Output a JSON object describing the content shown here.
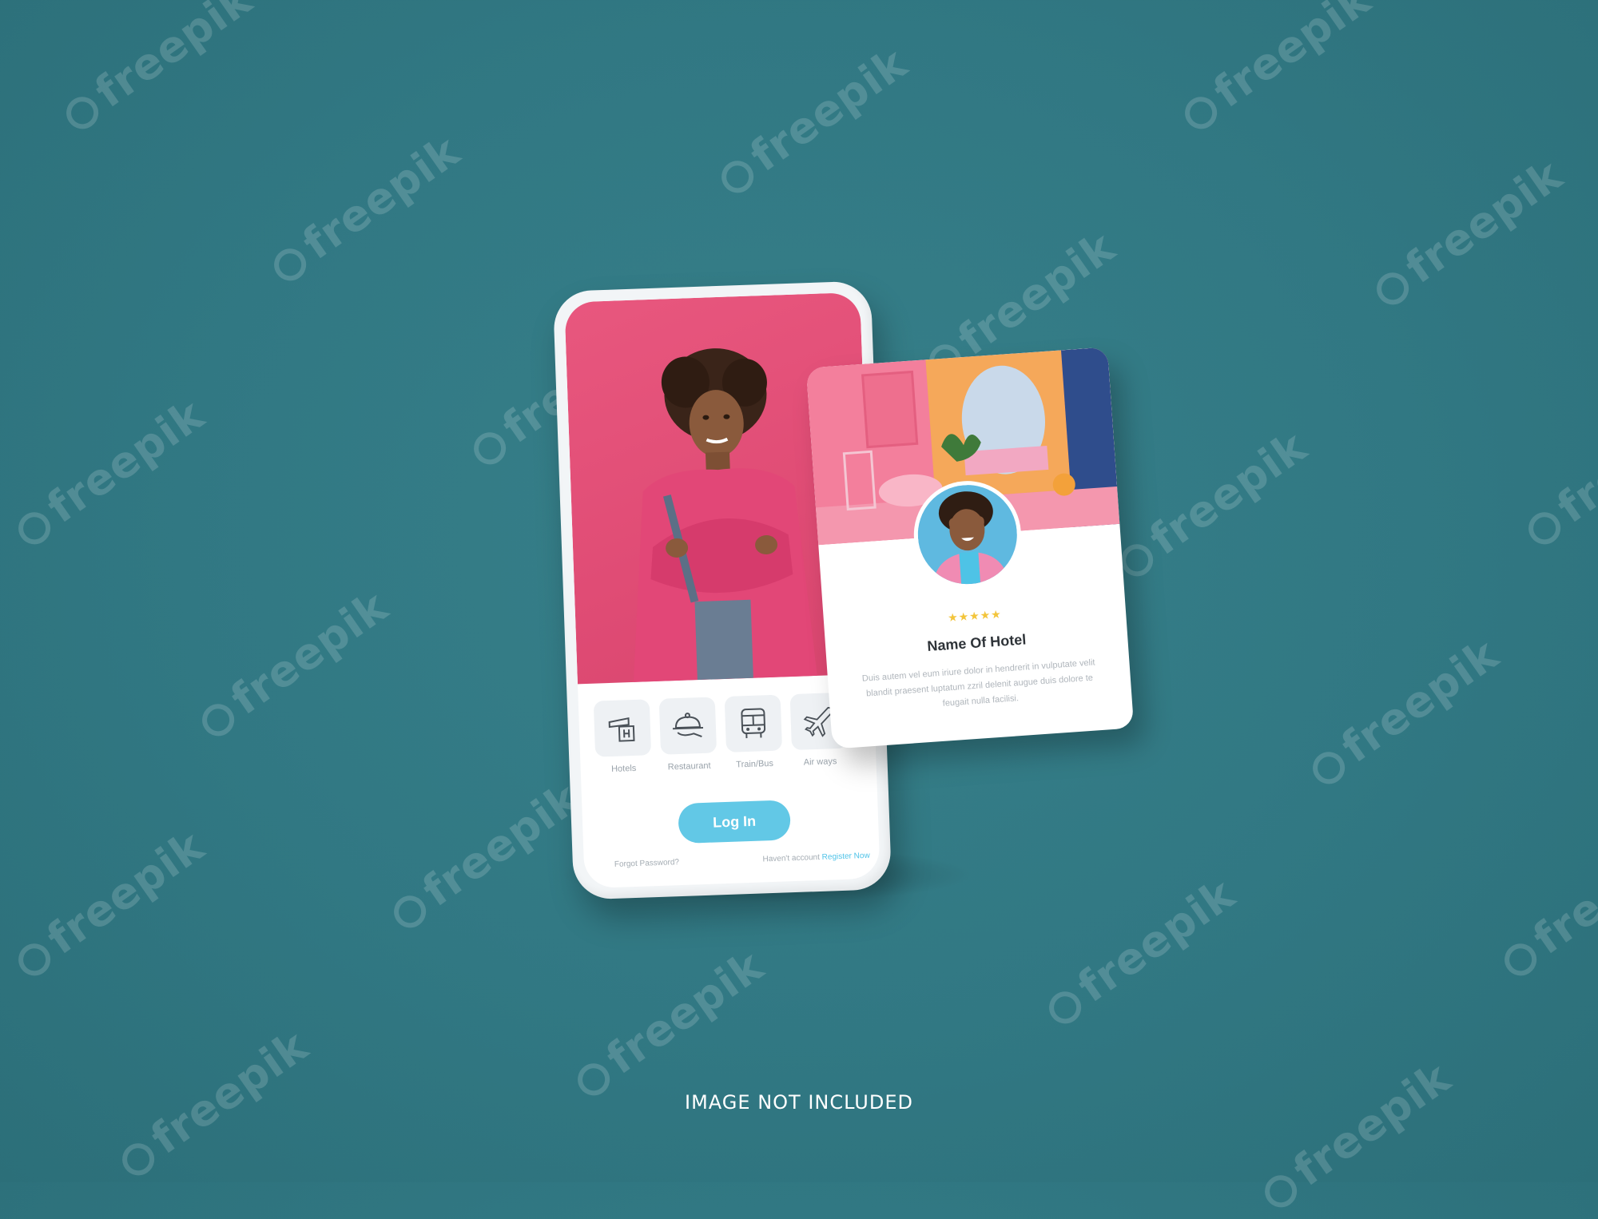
{
  "watermark_text": "freepik",
  "phone": {
    "categories": [
      {
        "label": "Hotels",
        "icon": "hotel-icon"
      },
      {
        "label": "Restaurant",
        "icon": "cloche-icon"
      },
      {
        "label": "Train/Bus",
        "icon": "bus-icon"
      },
      {
        "label": "Air ways",
        "icon": "airplane-icon"
      }
    ],
    "login_label": "Log In",
    "forgot_password": "Forgot Password?",
    "no_account": "Haven't account",
    "register_now": "Register Now"
  },
  "card": {
    "rating_stars": "★★★★★",
    "hotel_name": "Name Of Hotel",
    "description": "Duis autem vel eum iriure dolor in hendrerit in vulputate velit blandit praesent luptatum zzril delenit augue duis dolore te feugait nulla facilisi."
  },
  "footer_note": "IMAGE NOT INCLUDED",
  "colors": {
    "background": "#317883",
    "hero_pink": "#e04c75",
    "login_button": "#62c8e6",
    "register_link": "#4fc3e8",
    "stars": "#f3c53b"
  }
}
